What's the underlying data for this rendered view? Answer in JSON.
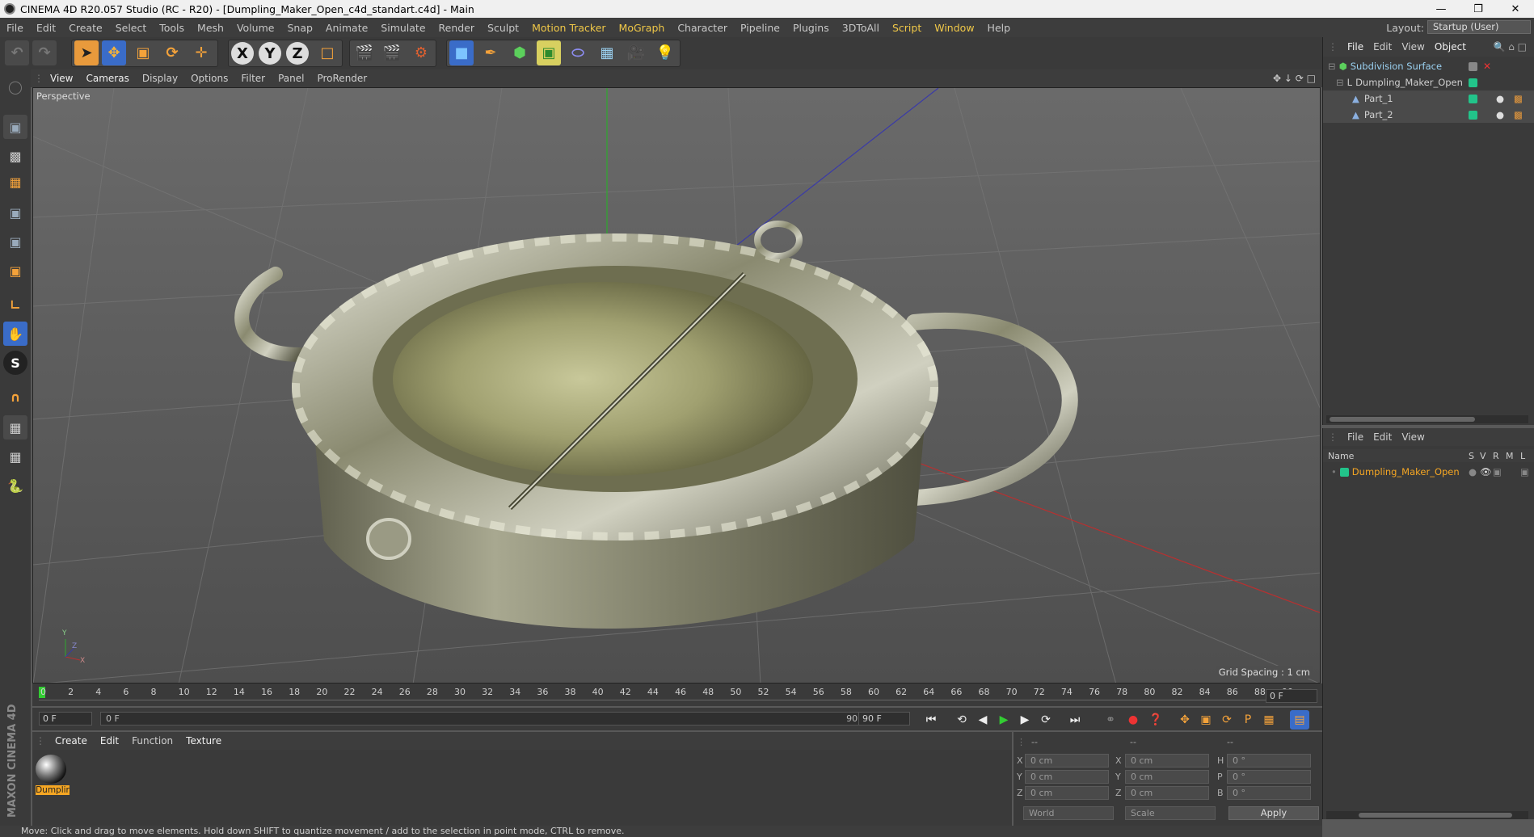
{
  "window": {
    "title": "CINEMA 4D R20.057 Studio (RC - R20) - [Dumpling_Maker_Open_c4d_standart.c4d] - Main"
  },
  "menu": [
    {
      "label": "File",
      "hl": false
    },
    {
      "label": "Edit",
      "hl": false
    },
    {
      "label": "Create",
      "hl": false
    },
    {
      "label": "Select",
      "hl": false
    },
    {
      "label": "Tools",
      "hl": false
    },
    {
      "label": "Mesh",
      "hl": false
    },
    {
      "label": "Volume",
      "hl": false
    },
    {
      "label": "Snap",
      "hl": false
    },
    {
      "label": "Animate",
      "hl": false
    },
    {
      "label": "Simulate",
      "hl": false
    },
    {
      "label": "Render",
      "hl": false
    },
    {
      "label": "Sculpt",
      "hl": false
    },
    {
      "label": "Motion Tracker",
      "hl": true
    },
    {
      "label": "MoGraph",
      "hl": true
    },
    {
      "label": "Character",
      "hl": false
    },
    {
      "label": "Pipeline",
      "hl": false
    },
    {
      "label": "Plugins",
      "hl": false
    },
    {
      "label": "3DToAll",
      "hl": false
    },
    {
      "label": "Script",
      "hl": true
    },
    {
      "label": "Window",
      "hl": true
    },
    {
      "label": "Help",
      "hl": false
    }
  ],
  "layout": {
    "label": "Layout:",
    "value": "Startup (User)"
  },
  "toolbar": {
    "x": "X",
    "y": "Y",
    "z": "Z"
  },
  "viewport": {
    "menu": [
      "View",
      "Cameras",
      "Display",
      "Options",
      "Filter",
      "Panel",
      "ProRender"
    ],
    "camera_label": "Perspective",
    "grid_spacing": "Grid Spacing : 1 cm",
    "axis_x": "X",
    "axis_y": "Y",
    "axis_z": "Z"
  },
  "timeline": {
    "ticks": [
      "0",
      "2",
      "4",
      "6",
      "8",
      "10",
      "12",
      "14",
      "16",
      "18",
      "20",
      "22",
      "24",
      "26",
      "28",
      "30",
      "32",
      "34",
      "36",
      "38",
      "40",
      "42",
      "44",
      "46",
      "48",
      "50",
      "52",
      "54",
      "56",
      "58",
      "60",
      "62",
      "64",
      "66",
      "68",
      "70",
      "72",
      "74",
      "76",
      "78",
      "80",
      "82",
      "84",
      "86",
      "88",
      "90"
    ],
    "current_frame": "0 F",
    "start_field": "0 F",
    "range_start": "0 F",
    "range_end": "90 F",
    "end_field": "90 F"
  },
  "materials": {
    "menu": [
      "Create",
      "Edit",
      "Function",
      "Texture"
    ],
    "items": [
      {
        "name": "Dumplir"
      }
    ]
  },
  "coordinates": {
    "headers": [
      "--",
      "--",
      "--"
    ],
    "rows": [
      {
        "a": "X",
        "av": "0 cm",
        "b": "X",
        "bv": "0 cm",
        "c": "H",
        "cv": "0 °"
      },
      {
        "a": "Y",
        "av": "0 cm",
        "b": "Y",
        "bv": "0 cm",
        "c": "P",
        "cv": "0 °"
      },
      {
        "a": "Z",
        "av": "0 cm",
        "b": "Z",
        "bv": "0 cm",
        "c": "B",
        "cv": "0 °"
      }
    ],
    "world": "World",
    "scale": "Scale",
    "apply": "Apply"
  },
  "status": "Move: Click and drag to move elements. Hold down SHIFT to quantize movement / add to the selection in point mode, CTRL to remove.",
  "logo": "MAXON CINEMA 4D",
  "objects": {
    "menu": [
      "File",
      "Edit",
      "View",
      "Object"
    ],
    "items": [
      {
        "name": "Subdivision Surface"
      },
      {
        "name": "Dumpling_Maker_Open"
      },
      {
        "name": "Part_1"
      },
      {
        "name": "Part_2"
      }
    ]
  },
  "layers": {
    "menu": [
      "File",
      "Edit",
      "View"
    ],
    "headers": {
      "name": "Name",
      "s": "S",
      "v": "V",
      "r": "R",
      "m": "M",
      "l": "L"
    },
    "items": [
      {
        "name": "Dumpling_Maker_Open"
      }
    ]
  },
  "colors": {
    "accent": "#f0c848",
    "layer_green": "#22c48a",
    "selected_text": "#f5a623"
  }
}
